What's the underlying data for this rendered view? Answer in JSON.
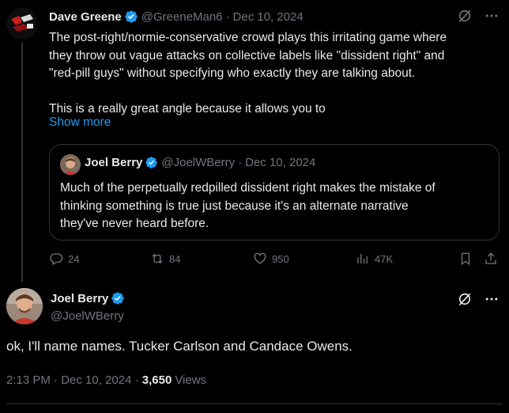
{
  "parent_tweet": {
    "author_name": "Dave Greene",
    "handle": "@GreeneMan6",
    "separator": "·",
    "date": "Dec 10, 2024",
    "text_line1": "The post-right/normie-conservative crowd plays this irritating game where",
    "text_line2": "they throw out vague attacks on collective labels like \"dissident right\" and",
    "text_line3": "\"red-pill guys\" without specifying who exactly they are talking about.",
    "text_line4": "This is a really great angle because it allows you to",
    "show_more": "Show more",
    "quote": {
      "author_name": "Joel Berry",
      "handle": "@JoelWBerry",
      "separator": "·",
      "date": "Dec 10, 2024",
      "text_line1": "Much of the perpetually redpilled dissident right makes the mistake of",
      "text_line2": "thinking something is true just because it's an alternate narrative",
      "text_line3": "they've never heard before."
    },
    "actions": {
      "replies": "24",
      "reposts": "84",
      "likes": "950",
      "views": "47K"
    }
  },
  "main_tweet": {
    "author_name": "Joel Berry",
    "handle": "@JoelWBerry",
    "text": "ok, I'll name names. Tucker Carlson and Candace Owens.",
    "time": "2:13 PM · Dec 10, 2024 ·",
    "views_count": "3,650",
    "views_label": "Views"
  },
  "icons": {
    "verified": "verified-badge-icon",
    "grok": "grok-icon",
    "more": "more-icon",
    "reply": "reply-icon",
    "repost": "repost-icon",
    "like": "like-icon",
    "views": "views-icon",
    "bookmark": "bookmark-icon",
    "share": "share-icon"
  },
  "colors": {
    "background": "#000000",
    "text": "#e7e9ea",
    "muted": "#71767b",
    "accent": "#1d9bf0",
    "border": "#2f3336"
  }
}
